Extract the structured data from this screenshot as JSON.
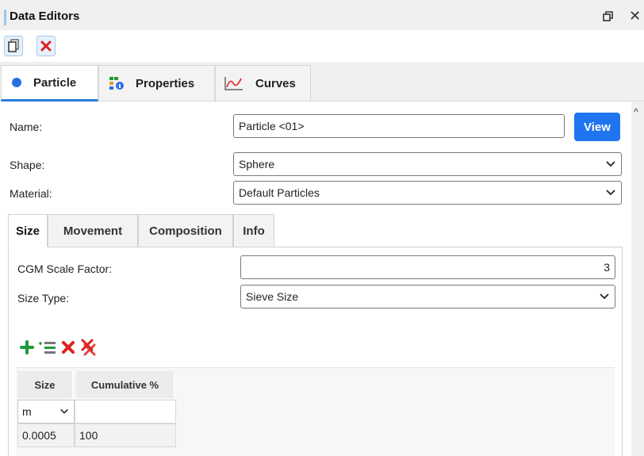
{
  "window": {
    "title": "Data Editors"
  },
  "main_tabs": [
    {
      "label": "Particle",
      "icon": "blue-circle-icon"
    },
    {
      "label": "Properties",
      "icon": "properties-icon"
    },
    {
      "label": "Curves",
      "icon": "curve-chart-icon"
    }
  ],
  "particle": {
    "name_label": "Name:",
    "name_value": "Particle <01>",
    "view_label": "View",
    "shape_label": "Shape:",
    "shape_value": "Sphere",
    "material_label": "Material:",
    "material_value": "Default Particles"
  },
  "sub_tabs": [
    {
      "label": "Size"
    },
    {
      "label": "Movement"
    },
    {
      "label": "Composition"
    },
    {
      "label": "Info"
    }
  ],
  "size": {
    "cgm_label": "CGM Scale Factor:",
    "cgm_value": "3",
    "size_type_label": "Size Type:",
    "size_type_value": "Sieve Size"
  },
  "grid": {
    "columns": [
      "Size",
      "Cumulative %"
    ],
    "unit": "m",
    "rows": [
      {
        "size": "0.0005",
        "cumulative": "100"
      }
    ]
  },
  "colors": {
    "accent": "#1f74f0",
    "tab_active": "#2b7de0",
    "add": "#1f9a3a",
    "delete": "#e02020"
  }
}
